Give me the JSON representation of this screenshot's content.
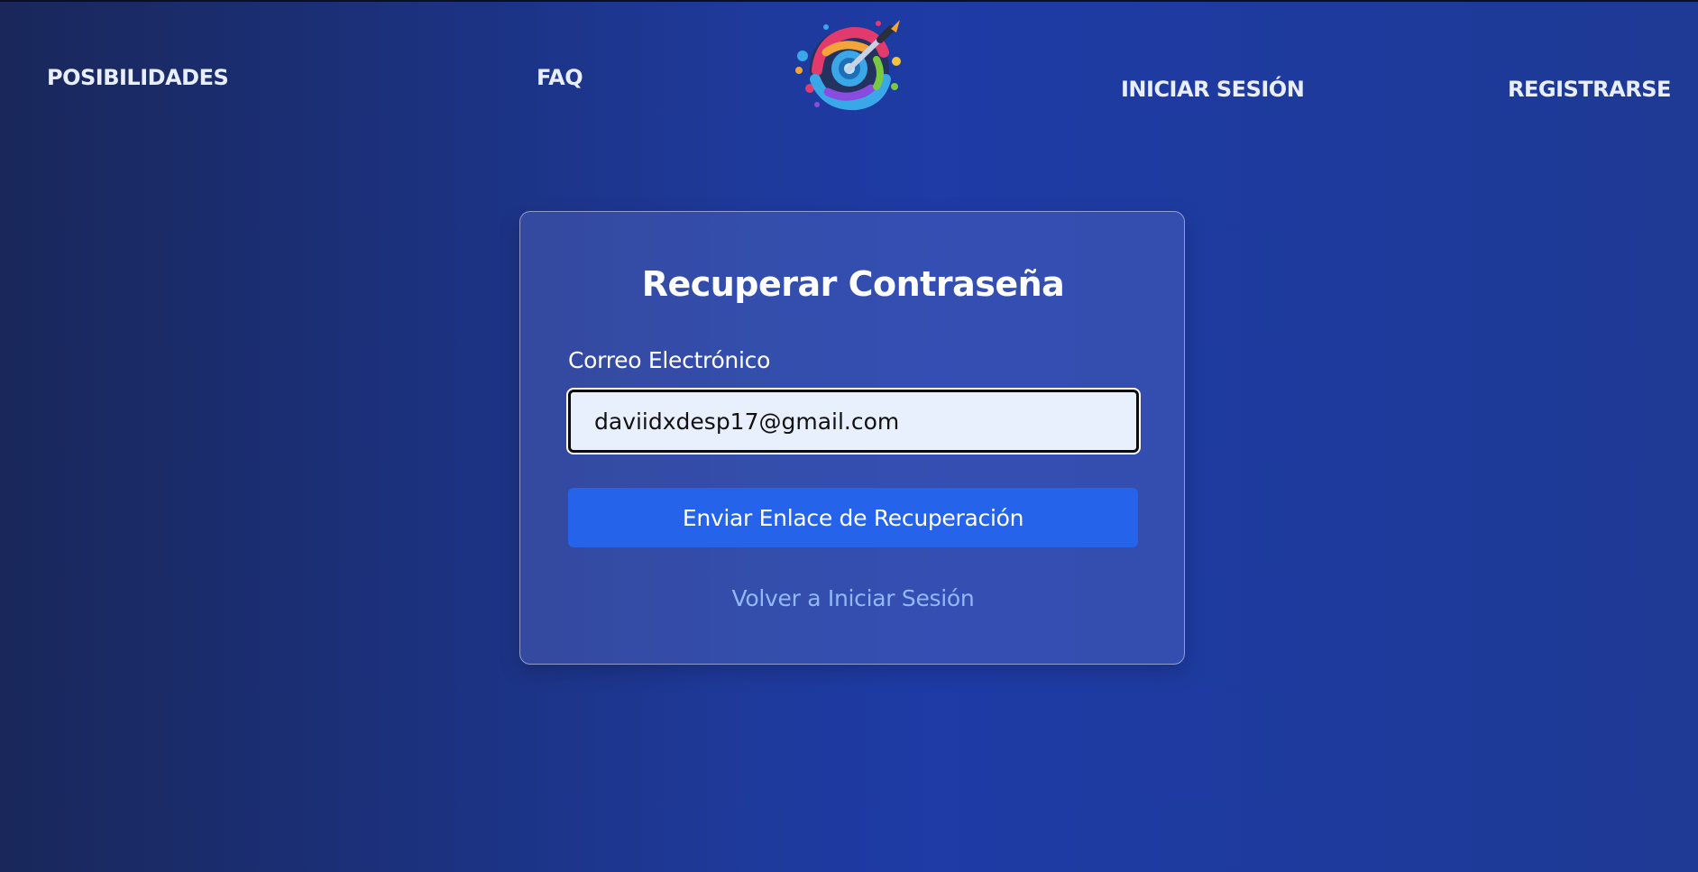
{
  "nav": {
    "posibilidades": "POSIBILIDADES",
    "faq": "FAQ",
    "iniciar_sesion": "INICIAR SESIÓN",
    "registrarse": "REGISTRARSE"
  },
  "logo": {
    "icon": "paint-palette-brush-logo"
  },
  "card": {
    "title": "Recuperar Contraseña",
    "email_label": "Correo Electrónico",
    "email_value": "daviidxdesp17@gmail.com",
    "submit_label": "Enviar Enlace de Recuperación",
    "back_link": "Volver a Iniciar Sesión"
  },
  "colors": {
    "button": "#2563eb",
    "link": "#93b8f7",
    "input_bg": "#e8effd"
  }
}
